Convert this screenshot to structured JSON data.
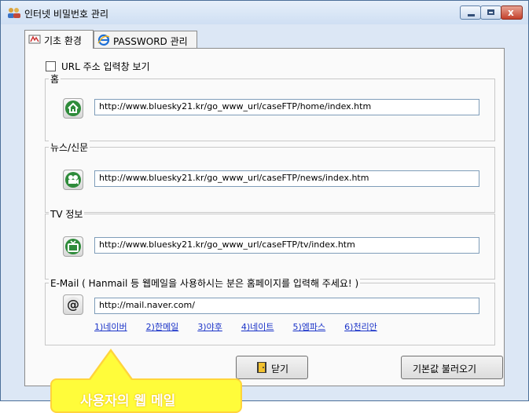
{
  "window": {
    "title": "인터넷 비밀번호 관리",
    "controls": {
      "minimize": "",
      "maximize": "",
      "close": "x"
    }
  },
  "tabs": [
    {
      "label": "기초 환경",
      "icon": "settings-icon",
      "active": true
    },
    {
      "label": "PASSWORD 관리",
      "icon": "ie-icon",
      "active": false
    }
  ],
  "options": {
    "show_url_bar_label": "URL 주소 입력창 보기",
    "checked": false
  },
  "groups": {
    "home": {
      "label": "홈",
      "icon": "home-icon",
      "url": "http://www.bluesky21.kr/go_www_url/caseFTP/home/index.htm"
    },
    "news": {
      "label": "뉴스/신문",
      "icon": "film-icon",
      "url": "http://www.bluesky21.kr/go_www_url/caseFTP/news/index.htm"
    },
    "tv": {
      "label": "TV 정보",
      "icon": "tv-icon",
      "url": "http://www.bluesky21.kr/go_www_url/caseFTP/tv/index.htm"
    },
    "email": {
      "label": "E-Mail ( Hanmail 등 웹메일을 사용하시는 분은 홈페이지를 입력해 주세요! )",
      "icon": "at-icon",
      "url": "http://mail.naver.com/",
      "links": [
        "1)네이버",
        "2)한메일",
        "3)야후",
        "4)네이트",
        "5)엠파스",
        "6)천리안"
      ]
    }
  },
  "buttons": {
    "close_label": "닫기",
    "defaults_label": "기본값 불러오기"
  },
  "tooltip": {
    "text": "사용자의 웹 메일"
  },
  "colors": {
    "link": "#1a33c8",
    "tooltip_bg": "#fffc3a",
    "tooltip_border": "#ffd43b",
    "home_icon": "#2e8b3a"
  }
}
